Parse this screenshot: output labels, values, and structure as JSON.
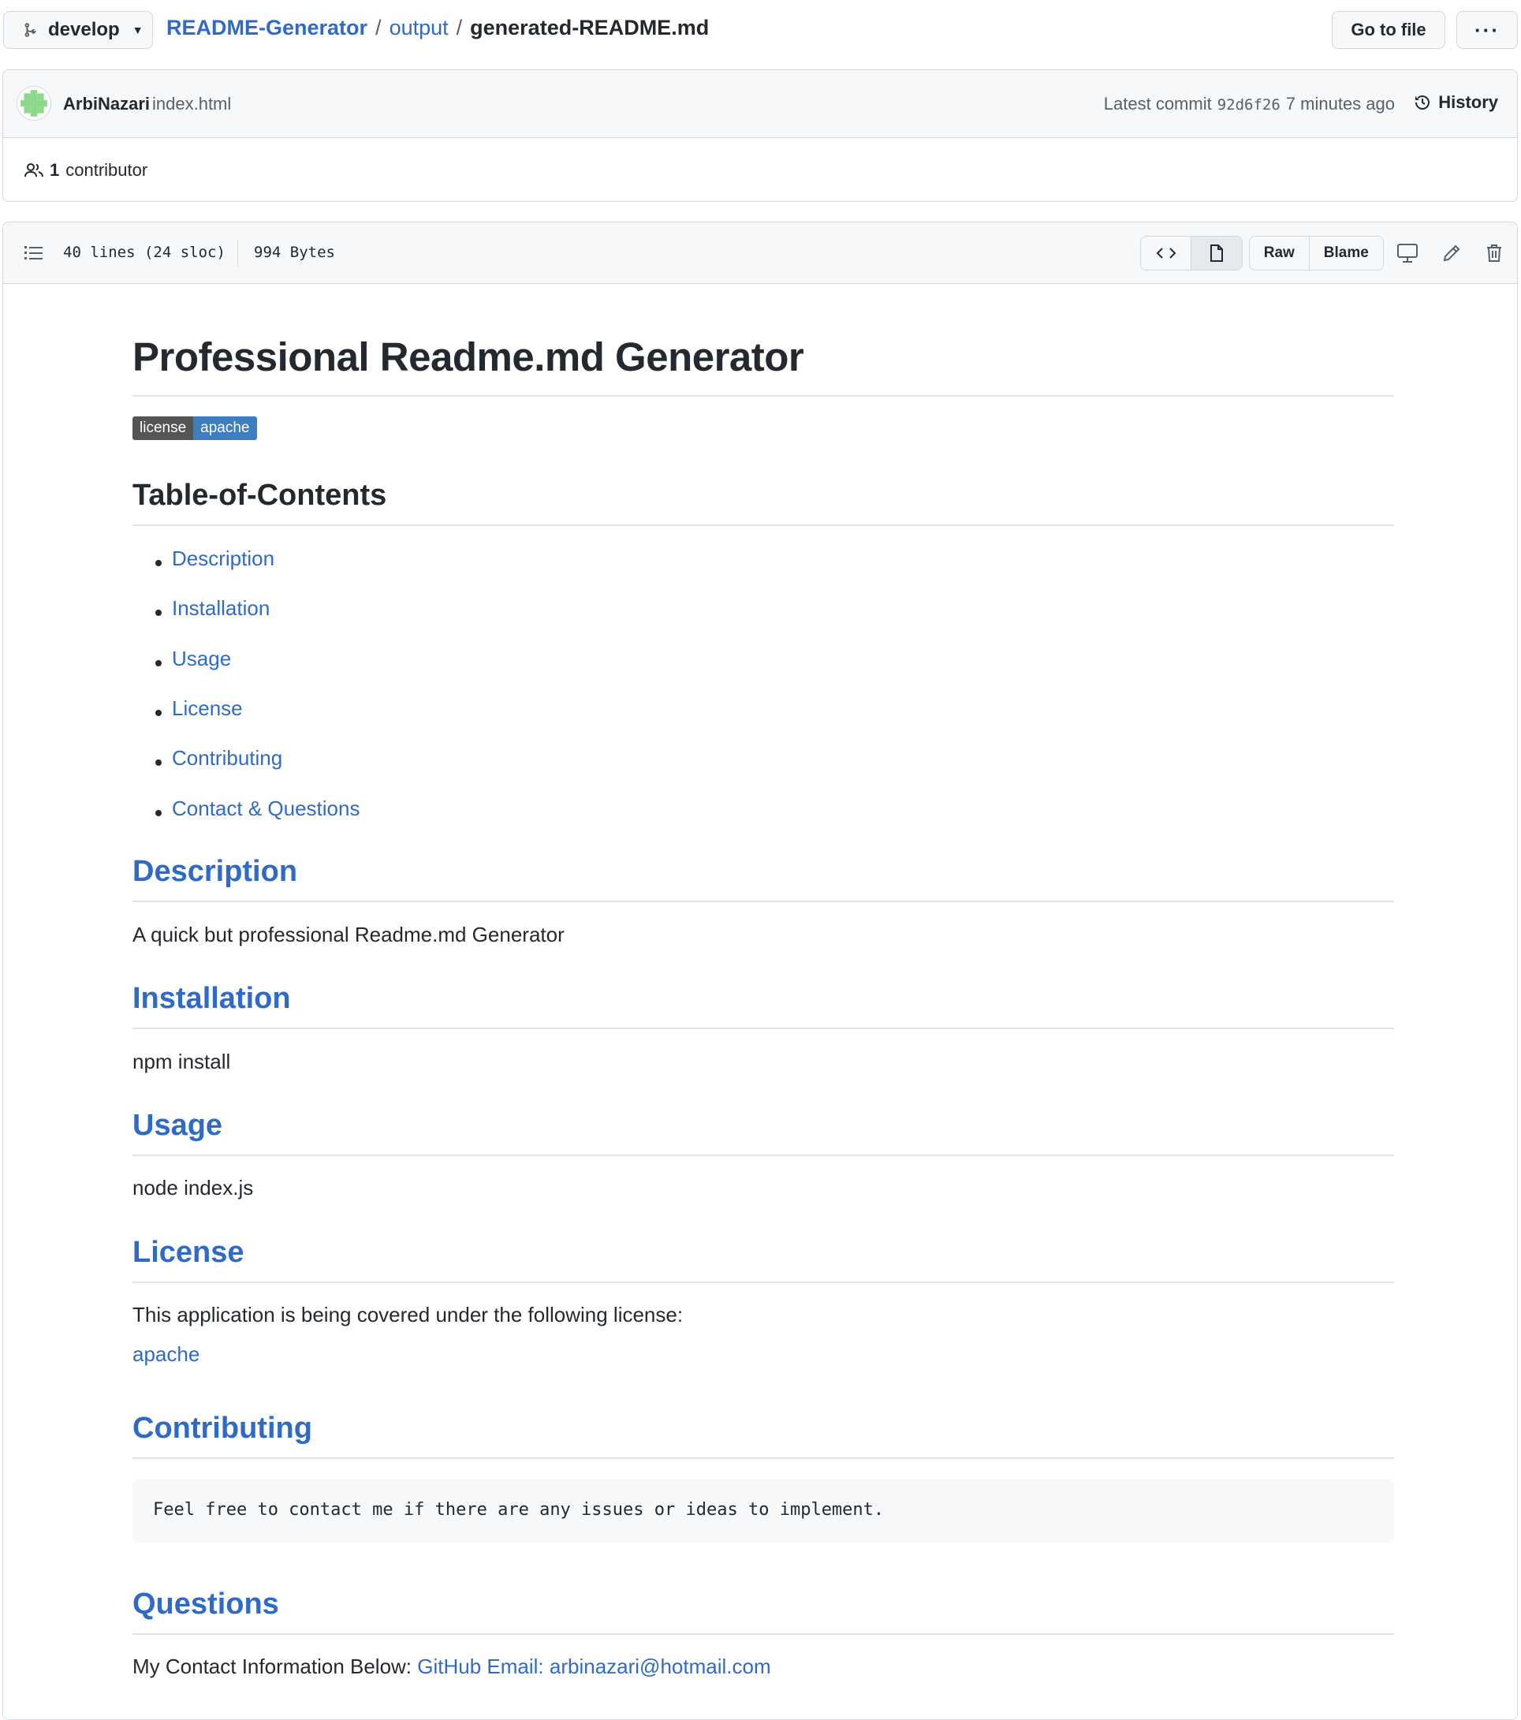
{
  "topbar": {
    "branch": "develop",
    "breadcrumb": {
      "repo": "README-Generator",
      "sep1": "/",
      "folder": "output",
      "sep2": "/",
      "file": "generated-README.md"
    },
    "goto_file": "Go to file",
    "more": "···"
  },
  "commit": {
    "author": "ArbiNazari",
    "message": "index.html",
    "latest_label": "Latest commit",
    "sha": "92d6f26",
    "time": "7 minutes ago",
    "history": "History",
    "contributors_count": "1",
    "contributors_label": "contributor"
  },
  "file": {
    "lines": "40 lines (24 sloc)",
    "size": "994 Bytes",
    "raw": "Raw",
    "blame": "Blame"
  },
  "markdown": {
    "title": "Professional Readme.md Generator",
    "badge": {
      "left": "license",
      "right": "apache"
    },
    "toc_heading": "Table-of-Contents",
    "toc": [
      "Description",
      "Installation",
      "Usage",
      "License",
      "Contributing",
      "Contact & Questions"
    ],
    "description_heading": "Description",
    "description_text": "A quick but professional Readme.md Generator",
    "installation_heading": "Installation",
    "installation_text": "npm install",
    "usage_heading": "Usage",
    "usage_text": "node index.js",
    "license_heading": "License",
    "license_text": "This application is being covered under the following license:",
    "license_link": "apache",
    "contributing_heading": "Contributing",
    "contributing_code": "Feel free to contact me if there are any issues or ideas to implement.",
    "questions_heading": "Questions",
    "questions_text": "My Contact Information Below: ",
    "questions_github": "GitHub",
    "questions_email": "Email: arbinazari@hotmail.com"
  },
  "colors": {
    "link": "#2f6bc6",
    "badge_left": "#555555",
    "badge_right": "#3c7ebf",
    "border": "#d0d7de"
  }
}
